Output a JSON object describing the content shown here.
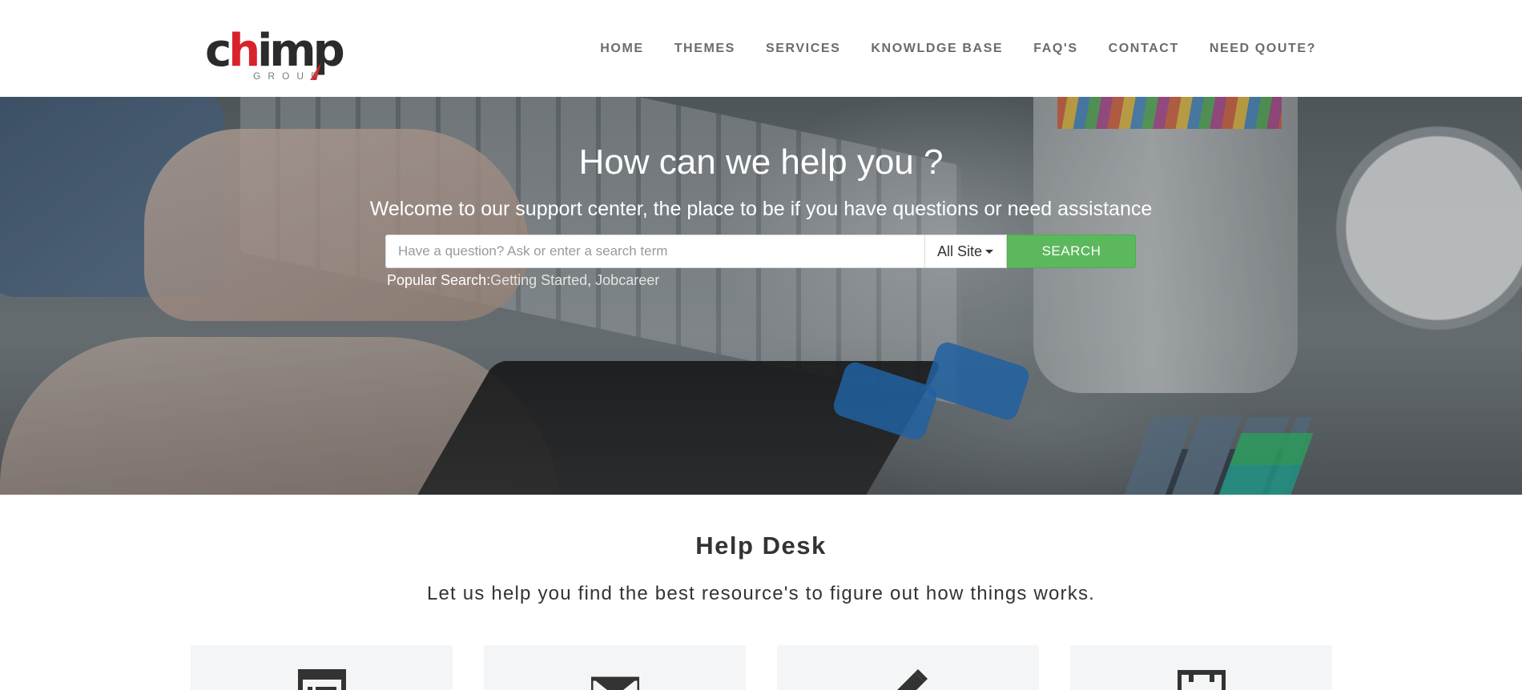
{
  "brand": {
    "logo_word_a": "c",
    "logo_word_b": "h",
    "logo_word_c": "imp",
    "logo_sub": "GROUP",
    "logo_colors": {
      "primary": "#2b2b2b",
      "accent": "#d8232a"
    }
  },
  "nav": {
    "items": [
      {
        "label": "HOME"
      },
      {
        "label": "THEMES"
      },
      {
        "label": "SERVICES"
      },
      {
        "label": "KNOWLDGE BASE"
      },
      {
        "label": "FAQ'S"
      },
      {
        "label": "CONTACT"
      },
      {
        "label": "NEED QOUTE?"
      }
    ]
  },
  "hero": {
    "title": "How can we help you ?",
    "subtitle": "Welcome to our support center, the place to be if you have questions or need assistance",
    "search": {
      "placeholder": "Have a question? Ask or enter a search term",
      "value": "",
      "scope": "All Site",
      "button": "SEARCH",
      "button_color": "#5cb85c"
    },
    "popular": {
      "label": "Popular Search:",
      "links": [
        "Getting Started",
        "Jobcareer"
      ],
      "separator": ", "
    }
  },
  "help_desk": {
    "title": "Help Desk",
    "subtitle": "Let us help you find the best resource's to figure out how things works.",
    "cards": [
      {
        "icon": "document-list-icon"
      },
      {
        "icon": "envelope-icon"
      },
      {
        "icon": "pencil-icon"
      },
      {
        "icon": "film-icon"
      }
    ]
  }
}
